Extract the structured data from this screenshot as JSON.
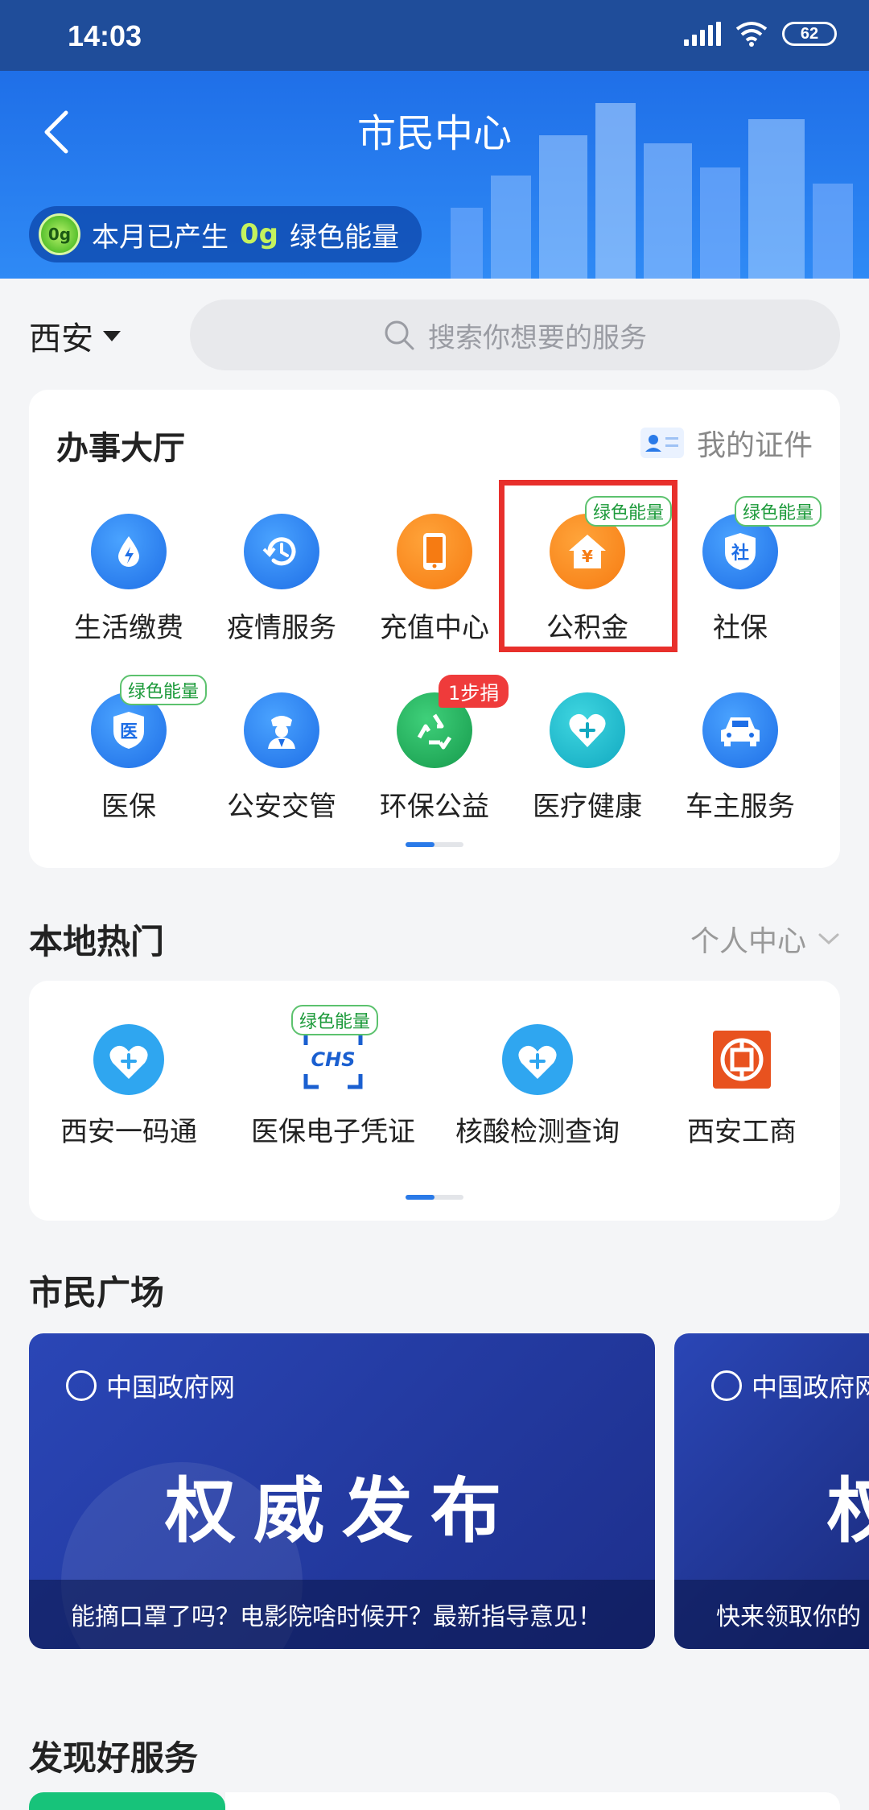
{
  "status_bar": {
    "time": "14:03",
    "battery": "62"
  },
  "header": {
    "title": "市民中心",
    "energy_prefix": "本月已产生",
    "energy_value": "0g",
    "energy_suffix": "绿色能量",
    "energy_badge": "0g"
  },
  "city": {
    "name": "西安"
  },
  "search": {
    "placeholder": "搜索你想要的服务"
  },
  "service_hall": {
    "title": "办事大厅",
    "my_certificates": "我的证件",
    "items": [
      {
        "label": "生活缴费",
        "icon": "lightning-drop-icon"
      },
      {
        "label": "疫情服务",
        "icon": "clock-history-icon"
      },
      {
        "label": "充值中心",
        "icon": "phone-icon"
      },
      {
        "label": "公积金",
        "icon": "house-yuan-icon",
        "badge": "绿色能量"
      },
      {
        "label": "社保",
        "icon": "shield-she-icon",
        "badge": "绿色能量"
      },
      {
        "label": "医保",
        "icon": "shield-yi-icon",
        "badge": "绿色能量"
      },
      {
        "label": "公安交管",
        "icon": "police-icon"
      },
      {
        "label": "环保公益",
        "icon": "recycle-icon",
        "badge": "1步捐"
      },
      {
        "label": "医疗健康",
        "icon": "heart-plus-icon"
      },
      {
        "label": "车主服务",
        "icon": "car-icon"
      }
    ]
  },
  "local_hot": {
    "title": "本地热门",
    "personal_center": "个人中心",
    "items": [
      {
        "label": "西安一码通",
        "icon": "heart-plus-icon"
      },
      {
        "label": "医保电子凭证",
        "icon": "chs-icon",
        "badge": "绿色能量"
      },
      {
        "label": "核酸检测查询",
        "icon": "heart-plus-icon"
      },
      {
        "label": "西安工商",
        "icon": "icbc-icon"
      }
    ]
  },
  "citizen_square": {
    "title": "市民广场",
    "banners": [
      {
        "brand": "中国政府网",
        "headline": "权威发布",
        "caption": "能摘口罩了吗？电影院啥时候开？最新指导意见！"
      },
      {
        "brand": "中国政府网",
        "headline": "权",
        "caption": "快来领取你的"
      }
    ]
  },
  "discover": {
    "title": "发现好服务"
  }
}
